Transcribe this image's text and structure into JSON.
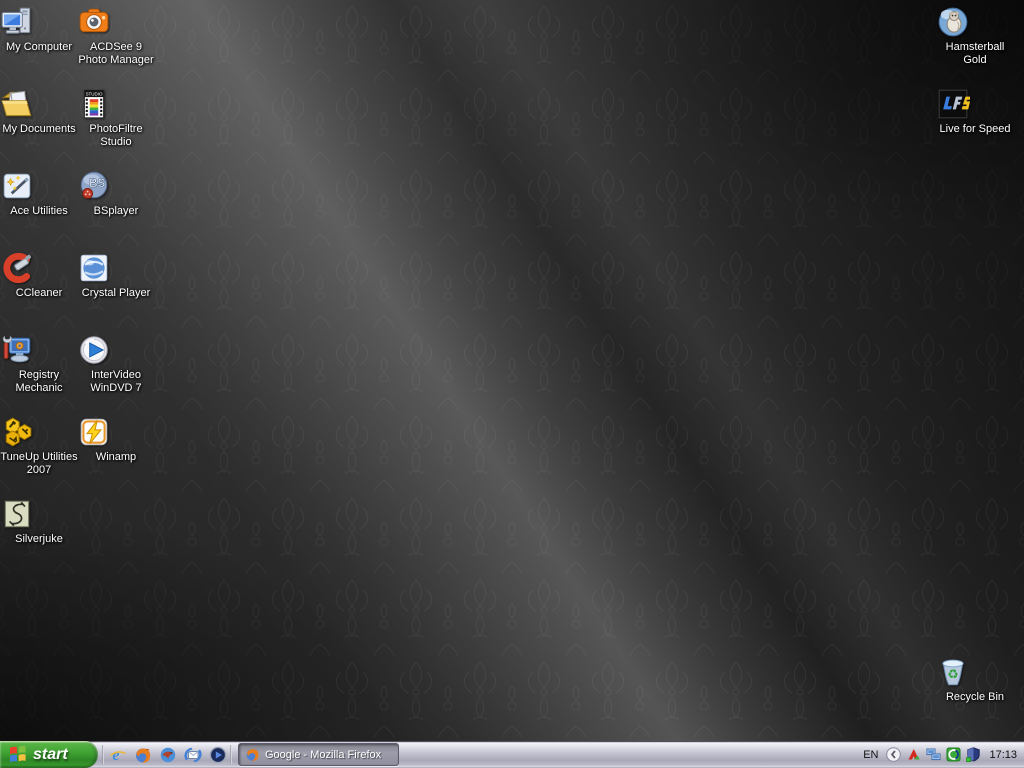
{
  "desktop": {
    "icons": [
      {
        "name": "my-computer",
        "label": "My Computer"
      },
      {
        "name": "acdsee-9",
        "label": "ACDSee 9\nPhoto Manager"
      },
      {
        "name": "my-documents",
        "label": "My Documents"
      },
      {
        "name": "photofiltre-studio",
        "label": "PhotoFiltre\nStudio"
      },
      {
        "name": "ace-utilities",
        "label": "Ace Utilities"
      },
      {
        "name": "bsplayer",
        "label": "BSplayer"
      },
      {
        "name": "ccleaner",
        "label": "CCleaner"
      },
      {
        "name": "crystal-player",
        "label": "Crystal Player"
      },
      {
        "name": "registry-mechanic",
        "label": "Registry\nMechanic"
      },
      {
        "name": "intervideo-windvd7",
        "label": "InterVideo\nWinDVD 7"
      },
      {
        "name": "tuneup-utilities",
        "label": "TuneUp Utilities\n2007"
      },
      {
        "name": "winamp",
        "label": "Winamp"
      },
      {
        "name": "silverjuke",
        "label": "Silverjuke"
      },
      {
        "name": "hamsterball-gold",
        "label": "Hamsterball\nGold"
      },
      {
        "name": "live-for-speed",
        "label": "Live for Speed"
      },
      {
        "name": "recycle-bin",
        "label": "Recycle Bin"
      }
    ]
  },
  "taskbar": {
    "start_label": "start",
    "quick_launch": [
      {
        "name": "internet-explorer"
      },
      {
        "name": "mozilla-firefox"
      },
      {
        "name": "mozilla-thunderbird"
      },
      {
        "name": "outlook-express"
      },
      {
        "name": "media-player-classic"
      }
    ],
    "task_buttons": [
      {
        "label": "Google - Mozilla Firefox",
        "icon": "firefox",
        "state": "active"
      }
    ],
    "tray": {
      "language": "EN",
      "icons": [
        {
          "name": "hide-icons-chevron"
        },
        {
          "name": "red-green-utility"
        },
        {
          "name": "network-connection"
        },
        {
          "name": "green-square-utility"
        },
        {
          "name": "security-shield"
        }
      ],
      "clock": "17:13"
    }
  },
  "colors": {
    "start_green": "#3fa133",
    "taskbar_silver": "#b9b9c7",
    "desktop_base": "#262626",
    "label_text": "#ffffff"
  }
}
